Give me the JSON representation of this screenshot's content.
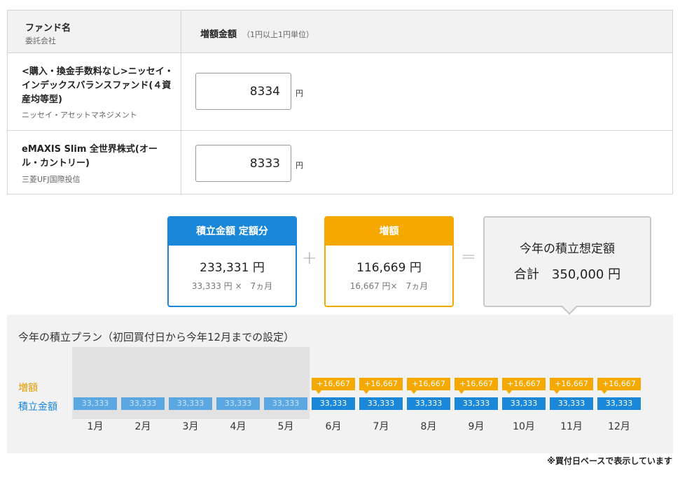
{
  "table": {
    "header_fund_name": "ファンド名",
    "header_company": "委託会社",
    "header_amount": "増額金額",
    "header_amount_note": "（1円以上1円単位）",
    "yen_unit": "円",
    "funds": [
      {
        "name": "<購入・換金手数料なし>ニッセイ・インデックスバランスファンド(４資産均等型)",
        "company": "ニッセイ・アセットマネジメント",
        "amount": "8334"
      },
      {
        "name": "eMAXIS Slim 全世界株式(オール・カントリー)",
        "company": "三菱UFJ国際投信",
        "amount": "8333"
      }
    ]
  },
  "summary": {
    "regular": {
      "title": "積立金額 定額分",
      "value": "233,331 円",
      "detail": "33,333 円 ×　7ヵ月"
    },
    "plus": "+",
    "increase": {
      "title": "増額",
      "value": "116,669 円",
      "detail": "16,667 円×　7ヵ月"
    },
    "equals": "=",
    "total": {
      "label": "今年の積立想定額",
      "value": "合計　350,000 円"
    }
  },
  "plan": {
    "title": "今年の積立プラン（初回買付日から今年12月までの設定）",
    "legend_increase": "増額",
    "legend_regular": "積立金額",
    "past_months": 5,
    "months": [
      {
        "label": "1月",
        "regular": "33,333",
        "increase": ""
      },
      {
        "label": "2月",
        "regular": "33,333",
        "increase": ""
      },
      {
        "label": "3月",
        "regular": "33,333",
        "increase": ""
      },
      {
        "label": "4月",
        "regular": "33,333",
        "increase": ""
      },
      {
        "label": "5月",
        "regular": "33,333",
        "increase": ""
      },
      {
        "label": "6月",
        "regular": "33,333",
        "increase": "+16,667"
      },
      {
        "label": "7月",
        "regular": "33,333",
        "increase": "+16,667"
      },
      {
        "label": "8月",
        "regular": "33,333",
        "increase": "+16,667"
      },
      {
        "label": "9月",
        "regular": "33,333",
        "increase": "+16,667"
      },
      {
        "label": "10月",
        "regular": "33,333",
        "increase": "+16,667"
      },
      {
        "label": "11月",
        "regular": "33,333",
        "increase": "+16,667"
      },
      {
        "label": "12月",
        "regular": "33,333",
        "increase": "+16,667"
      }
    ]
  },
  "footnote": "※買付日ベースで表示しています",
  "colors": {
    "regular": "#1a87d8",
    "increase": "#f4a800",
    "background": "#f2f2f2"
  }
}
